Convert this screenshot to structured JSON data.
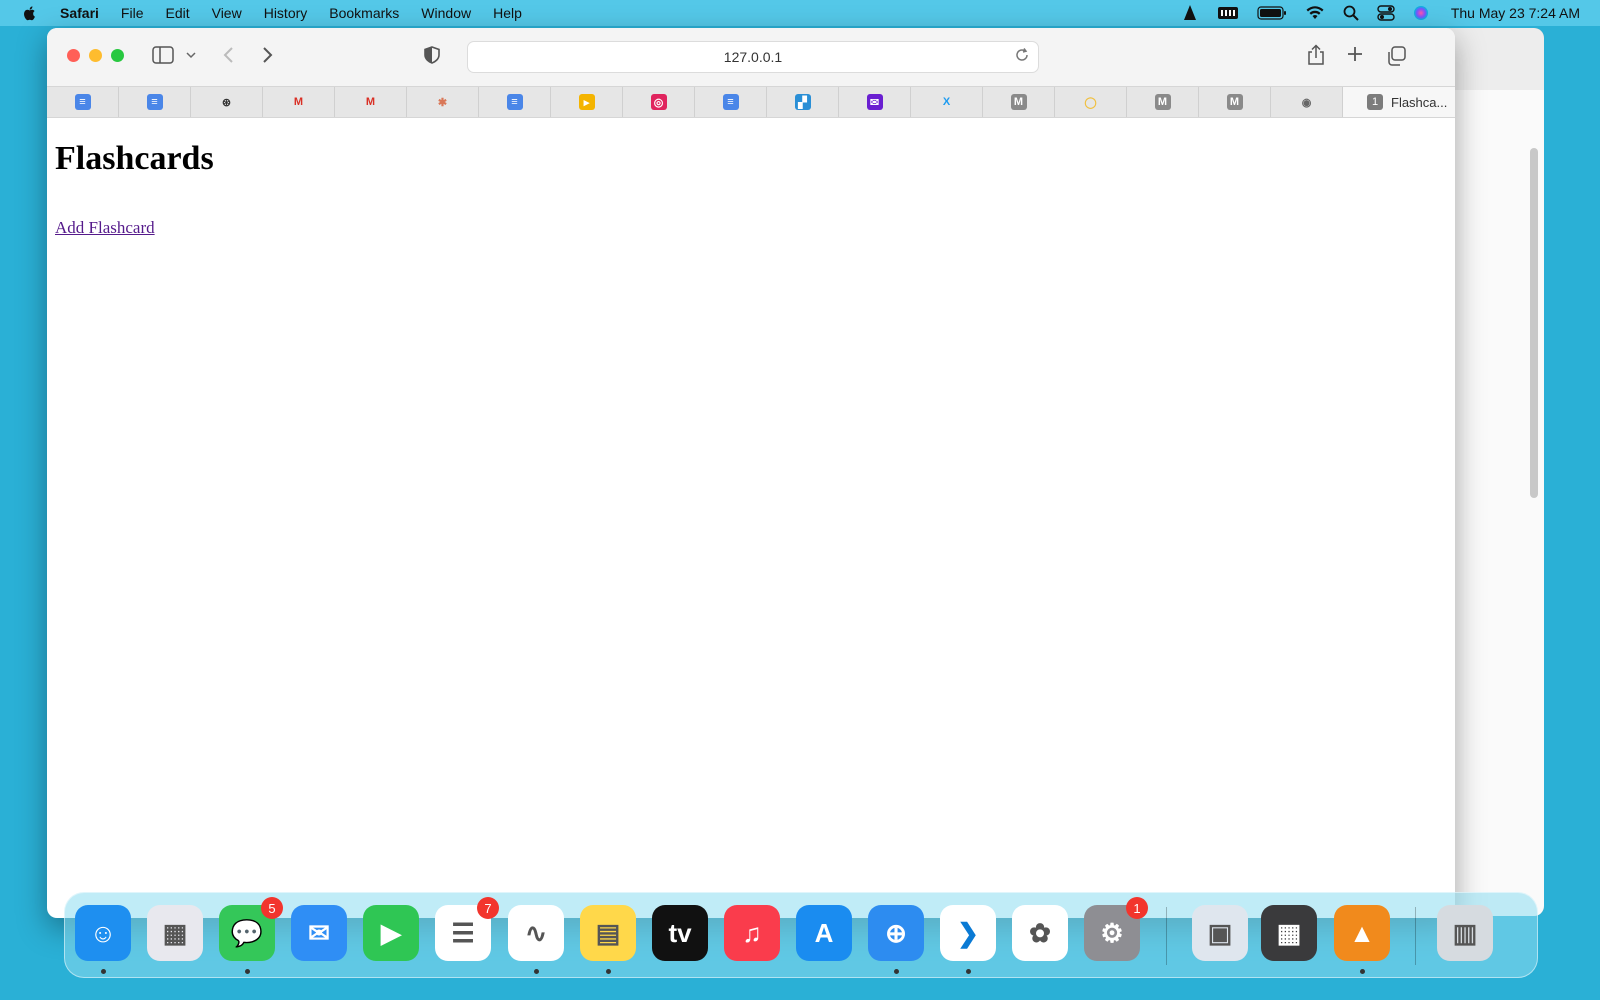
{
  "menubar": {
    "apple_icon": "apple-icon",
    "items": [
      "Safari",
      "File",
      "Edit",
      "View",
      "History",
      "Bookmarks",
      "Window",
      "Help"
    ],
    "clock": "Thu May 23  7:24 AM",
    "status_icons": [
      "vlc-icon",
      "keyboard-icon",
      "battery-icon",
      "wifi-icon",
      "search-icon",
      "control-center-icon",
      "siri-icon"
    ]
  },
  "browser": {
    "url": "127.0.0.1",
    "tabs": [
      {
        "icon": "google-docs-icon",
        "color": "#4a86e8"
      },
      {
        "icon": "google-docs-icon",
        "color": "#4a86e8"
      },
      {
        "icon": "chatgpt-icon",
        "color": "#333333"
      },
      {
        "icon": "gmail-icon",
        "color": "#d93025"
      },
      {
        "icon": "gmail-icon",
        "color": "#d93025"
      },
      {
        "icon": "claude-icon",
        "color": "#d97757"
      },
      {
        "icon": "google-docs-icon",
        "color": "#4a86e8"
      },
      {
        "icon": "airtable-icon",
        "color": "#f4b400"
      },
      {
        "icon": "target-icon",
        "color": "#e0245e"
      },
      {
        "icon": "google-docs-icon",
        "color": "#4a86e8"
      },
      {
        "icon": "squares-icon",
        "color": "#2a8fd6"
      },
      {
        "icon": "mail-icon",
        "color": "#6a1fd1"
      },
      {
        "icon": "x-icon",
        "color": "#1d9bf0"
      },
      {
        "icon": "m-icon",
        "color": "#8a8a8a"
      },
      {
        "icon": "lens-icon",
        "color": "#f0c040"
      },
      {
        "icon": "m-icon",
        "color": "#8a8a8a"
      },
      {
        "icon": "m-icon",
        "color": "#8a8a8a"
      },
      {
        "icon": "eye-icon",
        "color": "#666666"
      }
    ],
    "active_tab": {
      "number": "1",
      "title": "Flashca..."
    }
  },
  "page": {
    "heading": "Flashcards",
    "link": "Add Flashcard"
  },
  "dock": {
    "apps": [
      {
        "name": "finder",
        "icon": "finder-icon",
        "color": "#1e8ff0",
        "running": true
      },
      {
        "name": "launchpad",
        "icon": "launchpad-icon",
        "color": "#e8e8ee",
        "running": false
      },
      {
        "name": "messages",
        "icon": "messages-icon",
        "color": "#34c759",
        "badge": "5",
        "running": true
      },
      {
        "name": "mail",
        "icon": "mail-icon",
        "color": "#2f8ef5",
        "running": false
      },
      {
        "name": "facetime",
        "icon": "facetime-icon",
        "color": "#2fc654",
        "running": false
      },
      {
        "name": "reminders",
        "icon": "reminders-icon",
        "color": "#ffffff",
        "badge": "7",
        "running": false
      },
      {
        "name": "freeform",
        "icon": "freeform-icon",
        "color": "#ffffff",
        "running": true
      },
      {
        "name": "notes",
        "icon": "notes-icon",
        "color": "#ffd84a",
        "running": true
      },
      {
        "name": "apple-tv",
        "icon": "apple-tv-icon",
        "color": "#111111",
        "glyph": "tv",
        "running": false
      },
      {
        "name": "music",
        "icon": "music-icon",
        "color": "#fa3c4c",
        "running": false
      },
      {
        "name": "app-store",
        "icon": "app-store-icon",
        "color": "#1a8cf0",
        "running": false
      },
      {
        "name": "safari",
        "icon": "safari-icon",
        "color": "#2d8cf0",
        "running": true
      },
      {
        "name": "vscode",
        "icon": "vscode-icon",
        "color": "#ffffff",
        "running": true
      },
      {
        "name": "photos",
        "icon": "photos-icon",
        "color": "#ffffff",
        "running": false
      },
      {
        "name": "system-settings",
        "icon": "settings-icon",
        "color": "#8e8e93",
        "badge": "1",
        "running": false
      },
      {
        "name": "preview",
        "icon": "preview-icon",
        "color": "#dfe6ee",
        "running": false
      },
      {
        "name": "calculator",
        "icon": "calculator-icon",
        "color": "#3a3a3c",
        "running": false
      },
      {
        "name": "vlc",
        "icon": "vlc-icon",
        "color": "#f18a1c",
        "running": true
      },
      {
        "name": "trash",
        "icon": "trash-icon",
        "color": "#d6dbe0",
        "running": false
      }
    ]
  }
}
